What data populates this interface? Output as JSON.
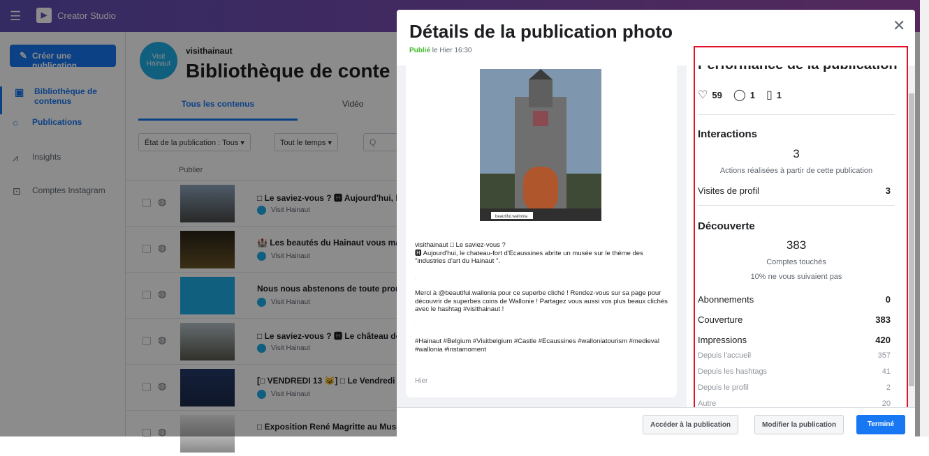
{
  "app": {
    "title": "Creator Studio"
  },
  "sidebar": {
    "create_label": "Créer une publication",
    "items": [
      {
        "label": "Bibliothèque de contenus"
      },
      {
        "label": "Publications"
      },
      {
        "label": "Insights"
      },
      {
        "label": "Comptes Instagram"
      }
    ]
  },
  "main": {
    "account": "visithainaut",
    "avatar_text": "Visit Hainaut",
    "title": "Bibliothèque de conte",
    "tabs": [
      "Tous les contenus",
      "Vidéo"
    ],
    "filters": {
      "status": "État de la publication : Tous ▾",
      "time": "Tout le temps ▾",
      "search_placeholder": "Q"
    },
    "column_header": "Publier",
    "rows": [
      {
        "title": "□ Le saviez-vous ? 🅷 Aujourd'hui, le",
        "author": "Visit Hainaut"
      },
      {
        "title": "🏰 Les beautés du Hainaut vous ma",
        "author": "Visit Hainaut"
      },
      {
        "title": "Nous nous abstenons de toute prom",
        "author": "Visit Hainaut"
      },
      {
        "title": "□ Le saviez-vous ? 🅷 Le château de",
        "author": "Visit Hainaut"
      },
      {
        "title": "[□ VENDREDI 13 😺] □ Le Vendredi",
        "author": "Visit Hainaut"
      },
      {
        "title": "□ Exposition René Magritte au Musé",
        "author": "Visit Hainaut"
      }
    ]
  },
  "dialog": {
    "title": "Détails de la publication photo",
    "status": "Publié",
    "status_time": "le Hier 16:30",
    "photo_credit": "beautiful.wallonia",
    "caption": [
      "visithainaut □ Le saviez-vous ?",
      "🅷 Aujourd'hui, le chateau-fort d'Ecaussines abrite un musée sur le thème des \"industries d'art du Hainaut \".",
      ".",
      ".",
      ".",
      "Merci à @beautiful.wallonia  pour ce superbe cliché ! Rendez-vous sur sa page pour découvrir de superbes coins de Wallonie ! Partagez vous aussi vos plus beaux clichés avec le hashtag #visithainaut !",
      ".",
      ".",
      ".",
      "#Hainaut #Belgium #Visitbelgium #Castle #Ecaussines #walloniatourism #medieval #wallonia #instamoment"
    ],
    "caption_time": "Hier",
    "performance": {
      "title": "Performance de la publication",
      "likes": "59",
      "comments": "1",
      "saves": "1"
    },
    "interactions": {
      "title": "Interactions",
      "total": "3",
      "total_label": "Actions réalisées à partir de cette publication",
      "profile_visits_label": "Visites de profil",
      "profile_visits": "3"
    },
    "discovery": {
      "title": "Découverte",
      "reach": "383",
      "reach_label": "Comptes touchés",
      "not_following": "10% ne vous suivaient pas",
      "rows": [
        {
          "label": "Abonnements",
          "value": "0"
        },
        {
          "label": "Couverture",
          "value": "383"
        },
        {
          "label": "Impressions",
          "value": "420"
        }
      ],
      "sub_rows": [
        {
          "label": "Depuis l'accueil",
          "value": "357"
        },
        {
          "label": "Depuis les hashtags",
          "value": "41"
        },
        {
          "label": "Depuis le profil",
          "value": "2"
        },
        {
          "label": "Autre",
          "value": "20"
        }
      ]
    },
    "buttons": {
      "view": "Accéder à la publication",
      "edit": "Modifier la publication",
      "done": "Terminé"
    }
  },
  "colors": {
    "accent": "#1877f2",
    "highlight": "#e0102a",
    "published": "#42b72a"
  }
}
